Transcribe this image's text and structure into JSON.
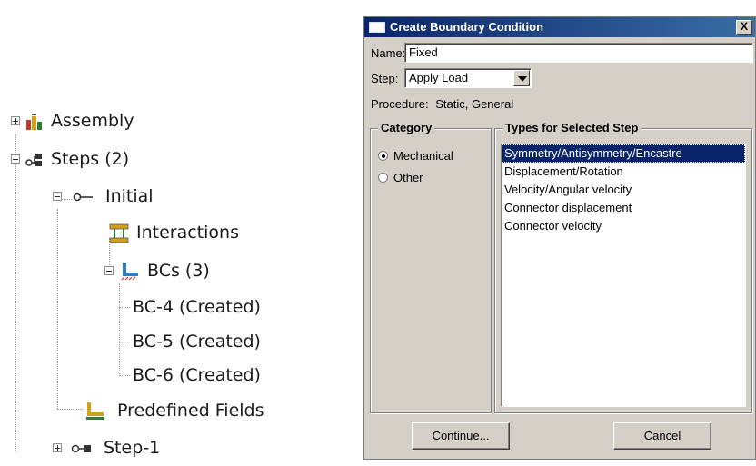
{
  "tree": {
    "assembly": {
      "label": "Assembly",
      "icon": "assembly-icon",
      "expander": "collapsed"
    },
    "steps": {
      "label": "Steps (2)",
      "icon": "steps-icon",
      "expander": "expanded"
    },
    "initial": {
      "label": "Initial",
      "icon": "initial-step-icon",
      "expander": "expanded"
    },
    "interactions": {
      "label": "Interactions",
      "icon": "interactions-icon"
    },
    "bcs": {
      "label": "BCs (3)",
      "icon": "boundary-conditions-icon",
      "expander": "expanded"
    },
    "bc_items": [
      {
        "label": "BC-4 (Created)"
      },
      {
        "label": "BC-5 (Created)"
      },
      {
        "label": "BC-6 (Created)"
      }
    ],
    "predefined": {
      "label": "Predefined Fields",
      "icon": "predefined-fields-icon"
    },
    "step1": {
      "label": "Step-1",
      "icon": "step-icon",
      "expander": "collapsed"
    }
  },
  "dialog": {
    "title": "Create Boundary Condition",
    "close_label": "X",
    "name_label": "Name:",
    "name_value": "Fixed",
    "step_label": "Step:",
    "step_value": "Apply Load",
    "procedure_label": "Procedure:",
    "procedure_value": "Static, General",
    "category_title": "Category",
    "categories": [
      {
        "label": "Mechanical",
        "selected": true
      },
      {
        "label": "Other",
        "selected": false
      }
    ],
    "types_title": "Types for Selected Step",
    "types": [
      {
        "label": "Symmetry/Antisymmetry/Encastre",
        "selected": true
      },
      {
        "label": "Displacement/Rotation",
        "selected": false
      },
      {
        "label": "Velocity/Angular velocity",
        "selected": false
      },
      {
        "label": "Connector displacement",
        "selected": false
      },
      {
        "label": "Connector velocity",
        "selected": false
      }
    ],
    "continue_label": "Continue...",
    "cancel_label": "Cancel"
  },
  "colors": {
    "titlebar_start": "#0a246a",
    "titlebar_end": "#3a6ea5",
    "dialog_bg": "#d4d0c8",
    "selection": "#0a246a"
  }
}
